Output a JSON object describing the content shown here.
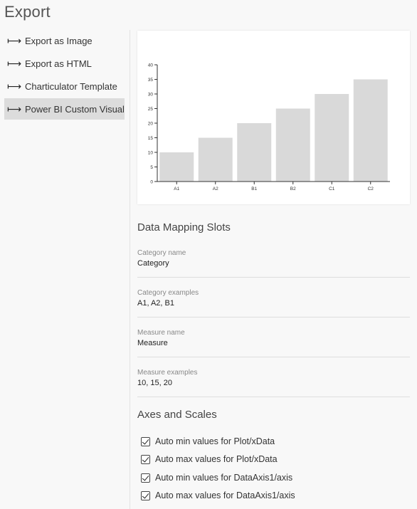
{
  "page": {
    "title": "Export"
  },
  "sidebar": {
    "items": [
      {
        "label": "Export as Image",
        "active": false
      },
      {
        "label": "Export as HTML",
        "active": false
      },
      {
        "label": "Charticulator Template",
        "active": false
      },
      {
        "label": "Power BI Custom Visual",
        "active": true
      }
    ],
    "arrow_glyph": "⟼"
  },
  "chart_data": {
    "type": "bar",
    "categories": [
      "A1",
      "A2",
      "B1",
      "B2",
      "C1",
      "C2"
    ],
    "values": [
      10,
      15,
      20,
      25,
      30,
      35
    ],
    "title": "",
    "xlabel": "",
    "ylabel": "",
    "ylim": [
      0,
      40
    ],
    "yticks": [
      0,
      5,
      10,
      15,
      20,
      25,
      30,
      35,
      40
    ],
    "bar_color": "#d9d9d9",
    "grid": false
  },
  "data_mapping": {
    "heading": "Data Mapping Slots",
    "fields": [
      {
        "label": "Category name",
        "value": "Category"
      },
      {
        "label": "Category examples",
        "value": "A1, A2, B1"
      },
      {
        "label": "Measure name",
        "value": "Measure"
      },
      {
        "label": "Measure examples",
        "value": "10, 15, 20"
      }
    ]
  },
  "axes_scales": {
    "heading": "Axes and Scales",
    "options": [
      {
        "label": "Auto min values for Plot/xData",
        "checked": true
      },
      {
        "label": "Auto max values for Plot/xData",
        "checked": true
      },
      {
        "label": "Auto min values for DataAxis1/axis",
        "checked": true
      },
      {
        "label": "Auto max values for DataAxis1/axis",
        "checked": true
      }
    ]
  },
  "colors": {
    "background": "#f8f8f8",
    "active_item": "#dcdcdc",
    "bar": "#d9d9d9"
  }
}
